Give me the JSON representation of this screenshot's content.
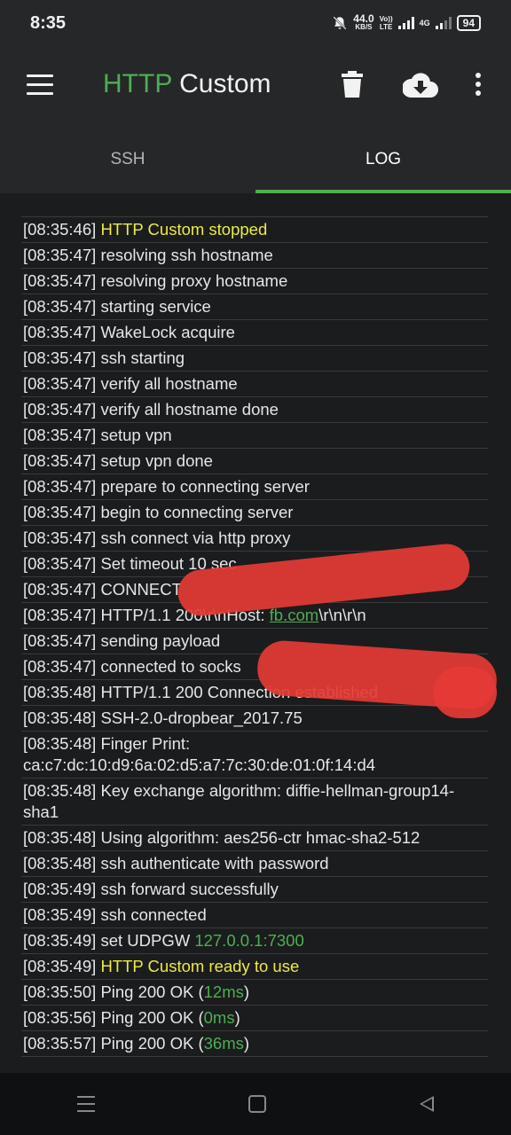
{
  "status_bar": {
    "time": "8:35",
    "speed_value": "44.0",
    "speed_unit": "KB/S",
    "volte_top": "Vo))",
    "volte_bottom": "LTE",
    "network": "4G",
    "battery": "94"
  },
  "toolbar": {
    "title_part1": "HTTP",
    "title_part2": " Custom"
  },
  "tabs": [
    {
      "label": "SSH",
      "active": false
    },
    {
      "label": "LOG",
      "active": true
    }
  ],
  "log": [
    {
      "time": "[08:35:46]",
      "text": "HTTP Custom stopped"
    },
    {
      "time": "[08:35:47]",
      "text": "resolving ssh hostname"
    },
    {
      "time": "[08:35:47]",
      "text": "resolving proxy hostname"
    },
    {
      "time": "[08:35:47]",
      "text": "starting service"
    },
    {
      "time": "[08:35:47]",
      "text": "WakeLock acquire"
    },
    {
      "time": "[08:35:47]",
      "text": "ssh starting"
    },
    {
      "time": "[08:35:47]",
      "text": "verify all hostname"
    },
    {
      "time": "[08:35:47]",
      "text": "verify all hostname done"
    },
    {
      "time": "[08:35:47]",
      "text": "setup vpn"
    },
    {
      "time": "[08:35:47]",
      "text": "setup vpn done"
    },
    {
      "time": "[08:35:47]",
      "text": "prepare to connecting server"
    },
    {
      "time": "[08:35:47]",
      "text": "begin to connecting server"
    },
    {
      "time": "[08:35:47]",
      "text": "ssh connect via http proxy"
    },
    {
      "time": "[08:35:47]",
      "text": "Set timeout 10 sec"
    },
    {
      "time": "[08:35:47]",
      "text": "CONNECT"
    },
    {
      "time": "[08:35:47]",
      "text": "HTTP/1.1 200\\r\\nHost: ",
      "link": "fb.com",
      "tail": "\\r\\n\\r\\n"
    },
    {
      "time": "[08:35:47]",
      "text": "sending payload"
    },
    {
      "time": "[08:35:47]",
      "text": "connected to socks"
    },
    {
      "time": "[08:35:48]",
      "text": "HTTP/1.1 200 Connection established"
    },
    {
      "time": "[08:35:48]",
      "text": "SSH-2.0-dropbear_2017.75"
    },
    {
      "time": "[08:35:48]",
      "text": "Finger Print: ca:c7:dc:10:d9:6a:02:d5:a7:7c:30:de:01:0f:14:d4"
    },
    {
      "time": "[08:35:48]",
      "text": "Key exchange algorithm: diffie-hellman-group14-sha1"
    },
    {
      "time": "[08:35:48]",
      "text": "Using algorithm: aes256-ctr hmac-sha2-512"
    },
    {
      "time": "[08:35:48]",
      "text": "ssh authenticate with password"
    },
    {
      "time": "[08:35:49]",
      "text": "ssh forward successfully"
    },
    {
      "time": "[08:35:49]",
      "text": "ssh connected"
    },
    {
      "time": "[08:35:49]",
      "text": "set UDPGW ",
      "green": "127.0.0.1:7300"
    },
    {
      "time": "[08:35:49]",
      "text": "HTTP Custom ready to use"
    },
    {
      "time": "[08:35:50]",
      "text": "Ping 200 OK (",
      "green": "12ms",
      "tail": ")"
    },
    {
      "time": "[08:35:56]",
      "text": "Ping 200 OK (",
      "green": "0ms",
      "tail": ")"
    },
    {
      "time": "[08:35:57]",
      "text": "Ping 200 OK (",
      "green": "36ms",
      "tail": ")"
    }
  ],
  "colors": {
    "accent": "#4caf50",
    "highlight": "#ecec3a",
    "background": "#1b1c1e",
    "redaction": "#e53935"
  }
}
